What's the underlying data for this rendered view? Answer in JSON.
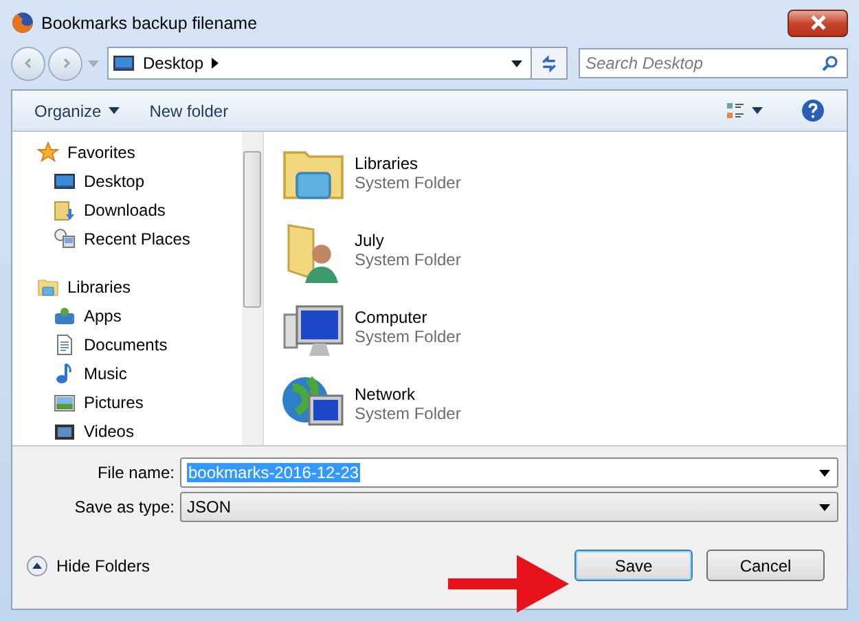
{
  "window": {
    "title": "Bookmarks backup filename"
  },
  "address": {
    "location": "Desktop",
    "search_placeholder": "Search Desktop"
  },
  "toolbar": {
    "organize": "Organize",
    "new_folder": "New folder"
  },
  "sidebar": {
    "groups": [
      {
        "label": "Favorites",
        "kind": "star",
        "children": [
          {
            "label": "Desktop",
            "kind": "desktop"
          },
          {
            "label": "Downloads",
            "kind": "downloads"
          },
          {
            "label": "Recent Places",
            "kind": "recent"
          }
        ]
      },
      {
        "label": "Libraries",
        "kind": "library",
        "children": [
          {
            "label": "Apps",
            "kind": "apps"
          },
          {
            "label": "Documents",
            "kind": "documents"
          },
          {
            "label": "Music",
            "kind": "music"
          },
          {
            "label": "Pictures",
            "kind": "pictures"
          },
          {
            "label": "Videos",
            "kind": "videos"
          }
        ]
      }
    ]
  },
  "items": [
    {
      "name": "Libraries",
      "type": "System Folder",
      "kind": "library"
    },
    {
      "name": "July",
      "type": "System Folder",
      "kind": "user"
    },
    {
      "name": "Computer",
      "type": "System Folder",
      "kind": "computer"
    },
    {
      "name": "Network",
      "type": "System Folder",
      "kind": "network"
    }
  ],
  "form": {
    "file_name_label": "File name:",
    "file_name": "bookmarks-2016-12-23",
    "file_name_selected": true,
    "type_label": "Save as type:",
    "type": "JSON"
  },
  "hide_folders": "Hide Folders",
  "buttons": {
    "save": "Save",
    "cancel": "Cancel"
  }
}
